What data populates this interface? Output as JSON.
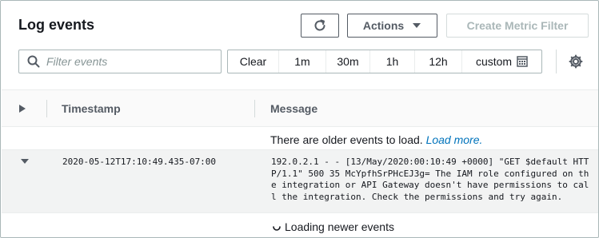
{
  "header": {
    "title": "Log events",
    "actions_label": "Actions",
    "create_label": "Create Metric Filter"
  },
  "filter": {
    "placeholder": "Filter events",
    "value": ""
  },
  "time_range": {
    "clear": "Clear",
    "options": [
      "1m",
      "30m",
      "1h",
      "12h"
    ],
    "custom": "custom"
  },
  "table": {
    "col_timestamp": "Timestamp",
    "col_message": "Message",
    "older_text": "There are older events to load.",
    "load_more": "Load more.",
    "rows": [
      {
        "timestamp": "2020-05-12T17:10:49.435-07:00",
        "message": "192.0.2.1 - - [13/May/2020:00:10:49 +0000] \"GET $default HTTP/1.1\" 500 35 McYpfhSrPHcEJ3g= The IAM role configured on the integration or API Gateway doesn't have permissions to call the integration. Check the permissions and try again."
      }
    ],
    "loading_text": "Loading newer events"
  },
  "icons": {
    "refresh": "refresh-icon",
    "caret": "caret-down-icon",
    "search": "search-icon",
    "calendar": "calendar-icon",
    "settings": "gear-icon",
    "expand": "caret-right-icon",
    "collapse": "caret-down-icon",
    "spinner": "spinner-icon"
  },
  "colors": {
    "link": "#0073bb",
    "text": "#16191f",
    "muted": "#545b64",
    "disabled": "#aab7b8",
    "row_bg": "#f2f3f3"
  }
}
